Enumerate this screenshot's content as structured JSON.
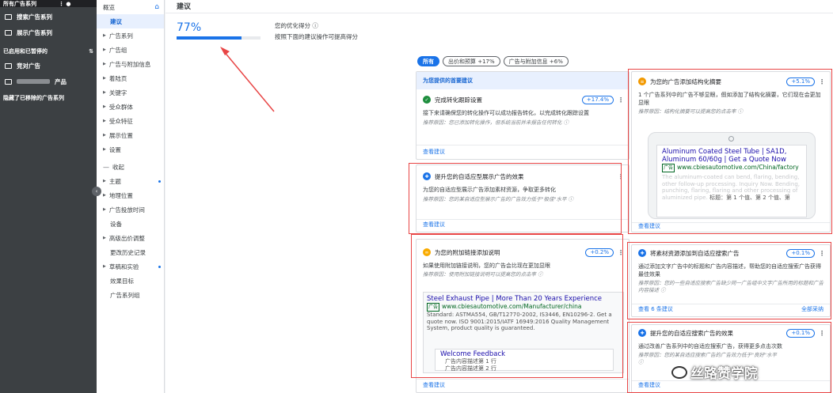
{
  "sidebar": {
    "top_label": "所有广告系列",
    "items": [
      {
        "label": "搜索广告系列"
      },
      {
        "label": "展示广告系列"
      }
    ],
    "status_label": "已启用和已暂停的",
    "sub_items": [
      {
        "label": "竞对广告"
      },
      {
        "label": "产品"
      }
    ],
    "hidden_label": "隐藏了已移除的广告系列"
  },
  "nav": {
    "items": [
      {
        "label": "概览",
        "active": false,
        "caret": false
      },
      {
        "label": "建议",
        "active": true,
        "caret": false
      },
      {
        "label": "广告系列",
        "caret": true
      },
      {
        "label": "广告组",
        "caret": true
      },
      {
        "label": "广告与附加信息",
        "caret": true
      },
      {
        "label": "着陆页",
        "caret": true
      },
      {
        "label": "关键字",
        "caret": true
      },
      {
        "label": "受众群体",
        "caret": true
      },
      {
        "label": "受众特征",
        "caret": true
      },
      {
        "label": "展示位置",
        "caret": true
      },
      {
        "label": "设置",
        "caret": true
      }
    ],
    "collapse_label": "收起",
    "items2": [
      {
        "label": "主题",
        "caret": true,
        "dot": true
      },
      {
        "label": "地理位置",
        "caret": true
      },
      {
        "label": "广告投放时间",
        "caret": true
      },
      {
        "label": "设备",
        "caret": false
      },
      {
        "label": "高级出价调整",
        "caret": true
      },
      {
        "label": "更改历史记录",
        "caret": false
      },
      {
        "label": "草稿和实验",
        "caret": true,
        "dot": true
      },
      {
        "label": "效果目标",
        "caret": false
      },
      {
        "label": "广告系列组",
        "caret": false
      }
    ]
  },
  "page": {
    "title": "建议",
    "score_value": "77%",
    "score_fraction": 0.77,
    "score_label": "您的优化得分 ⓘ",
    "score_hint": "按照下面的建议操作可提高得分"
  },
  "filters": [
    {
      "label": "所有",
      "selected": true
    },
    {
      "label": "出价和预算 +17%",
      "selected": false
    },
    {
      "label": "广告与附加信息 +6%",
      "selected": false
    }
  ],
  "cards": {
    "top_banner": "为您提供的首要建议",
    "conversion": {
      "title": "完成转化跟踪设置",
      "pct": "+17.4%",
      "body": "接下来请确保您的转化操作可以成功报告转化，以完成转化跟踪设置",
      "reason": "推荐原因：您已添加转化操作，但系统当前并未报告任何转化 ⓘ",
      "link": "查看建议"
    },
    "responsive_display": {
      "title": "提升您的自适应型展示广告的效果",
      "body": "为您的自适应型展示广告添加素材资源，争取更多转化",
      "reason": "推荐原因：您的某自适应型展示广告的广告效力低于\"极佳\"水平 ⓘ",
      "link": "查看建议"
    },
    "sitelinks": {
      "title": "为您的附加链接添加说明",
      "pct": "+0.2%",
      "body": "如果使用附加链接说明，您的广告会比现在更加显眼",
      "reason": "推荐原因：使用附加链接说明可以提高您的点击率 ⓘ",
      "ad_headline": "Steel Exhaust Pipe | More Than 20 Years Experience",
      "ad_tag": "广告",
      "ad_url": "www.cbiesautomotive.com/Manufacturer/china",
      "ad_desc": "Standard: ASTMA554, GB/T12770-2002, IS3446, EN10296-2. Get a quote now. ISO 9001:2015/IATF 16949:2016 Quality Management System, product quality is guaranteed.",
      "sitelink_title": "Welcome Feedback",
      "sitelink_line1": "广告内容描述第 1 行",
      "sitelink_line2": "广告内容描述第 2 行",
      "link": "查看建议"
    },
    "structured": {
      "title": "为您的广告添加结构化摘要",
      "pct": "+5.1%",
      "body": "1 个广告系列中的广告不够显眼，假如添加了结构化摘要，它们现在会更加显眼",
      "reason": "推荐原因：结构化摘要可以提高您的点击率 ⓘ",
      "ad_headline": "Aluminum Coated Steel Tube | SA1D, Aluminum 60/60g | Get a Quote Now",
      "ad_tag": "广告",
      "ad_url": "www.cbiesautomotive.com/China/factory",
      "ad_desc_fade": "The aluminum-coated can bend, flaring, bending, other follow-up processing. Inquiry Now. Bending, punching, flaring, flaring and other processing of aluminized pipe.",
      "ad_desc_tail": "标题：第 1 个值、第 2 个值、第",
      "link": "查看建议"
    },
    "rsa_headlines": {
      "title": "将素材资源添加到自适应搜索广告",
      "pct": "+0.1%",
      "body": "通过添加文字广告中的标题和广告内容描述，帮助您的自适应搜索广告获得最佳效果",
      "reason": "推荐原因：您的一些自适应搜索广告缺少同一广告组中文字广告所用的标题和广告内容描述 ⓘ",
      "link": "查看 6 条建议",
      "link_right": "全部采纳"
    },
    "rsa_improve": {
      "title": "提升您的自适应搜索广告的效果",
      "pct": "+0.1%",
      "body": "通过改善广告系列中的自适应搜索广告，获得更多点击次数",
      "reason": "推荐原因：您的某自适应搜索广告的广告效力低于\"良好\"水平 ⓘ",
      "link": "查看建议"
    }
  },
  "watermark": "丝路赞学院",
  "colors": {
    "accent": "#1a73e8",
    "annotation_red": "#e84545",
    "sidebar_dark": "#3c4043"
  }
}
